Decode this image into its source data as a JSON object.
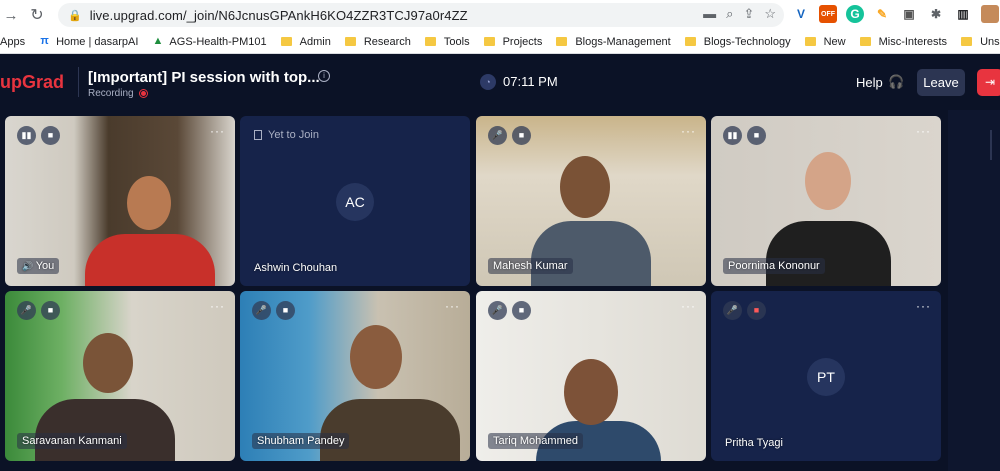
{
  "browser": {
    "url": "live.upgrad.com/_join/N6JcnusGPAnkH6KO4ZZR3TCJ97a0r4ZZ",
    "bookmarks": [
      {
        "label": "Apps",
        "icon": "apps-grid-icon"
      },
      {
        "label": "Home | dasarpAI",
        "icon": "site-icon"
      },
      {
        "label": "AGS-Health-PM101",
        "icon": "drive-icon"
      },
      {
        "label": "Admin",
        "icon": "folder-icon"
      },
      {
        "label": "Research",
        "icon": "folder-icon"
      },
      {
        "label": "Tools",
        "icon": "folder-icon"
      },
      {
        "label": "Projects",
        "icon": "folder-icon"
      },
      {
        "label": "Blogs-Management",
        "icon": "folder-icon"
      },
      {
        "label": "Blogs-Technology",
        "icon": "folder-icon"
      },
      {
        "label": "New",
        "icon": "folder-icon"
      },
      {
        "label": "Misc-Interests",
        "icon": "folder-icon"
      },
      {
        "label": "Unsorted",
        "icon": "folder-icon"
      }
    ],
    "ext_off_label": "OFF"
  },
  "header": {
    "logo": "upGrad",
    "title": "[Important] PI session with top...",
    "recording_label": "Recording",
    "time": "07:11 PM",
    "help_label": "Help",
    "leave_label": "Leave"
  },
  "participants": [
    {
      "name": "You",
      "status": "video",
      "mic": "on"
    },
    {
      "name": "Ashwin Chouhan",
      "status": "yet-to-join",
      "initials": "AC",
      "status_label": "Yet to Join"
    },
    {
      "name": "Mahesh Kumar",
      "status": "video",
      "mic": "muted"
    },
    {
      "name": "Poornima Kononur",
      "status": "video",
      "mic": "on"
    },
    {
      "name": "Saravanan Kanmani",
      "status": "video",
      "mic": "muted"
    },
    {
      "name": "Shubham Pandey",
      "status": "video",
      "mic": "muted"
    },
    {
      "name": "Tariq Mohammed",
      "status": "video",
      "mic": "muted"
    },
    {
      "name": "Pritha Tyagi",
      "status": "no-video",
      "initials": "PT",
      "mic": "muted"
    }
  ],
  "colors": {
    "brand": "#e8343f",
    "background": "#0b1226",
    "tile": "#16234a"
  }
}
